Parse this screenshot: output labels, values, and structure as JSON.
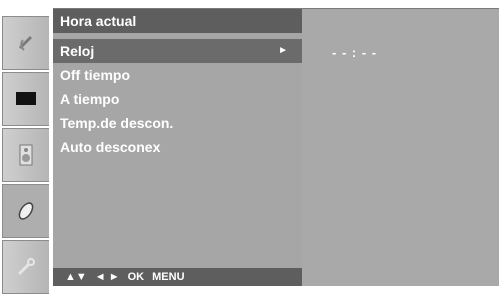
{
  "menu": {
    "title": "Hora actual",
    "items": [
      {
        "label": "Reloj",
        "selected": true,
        "has_submenu": true,
        "arrow": "►"
      },
      {
        "label": "Off tiempo",
        "selected": false
      },
      {
        "label": "A tiempo",
        "selected": false
      },
      {
        "label": "Temp.de descon.",
        "selected": false
      },
      {
        "label": "Auto desconex",
        "selected": false
      }
    ]
  },
  "value": {
    "clock": "- - : - -"
  },
  "footer": {
    "nav_updown": "▲▼",
    "nav_leftright": "◄ ►",
    "ok": "OK",
    "menu": "MENU"
  },
  "sidebar": {
    "tabs": [
      {
        "icon": "satellite-dish-icon",
        "active": false
      },
      {
        "icon": "screen-icon",
        "active": false
      },
      {
        "icon": "speaker-icon",
        "active": false
      },
      {
        "icon": "clock-icon",
        "active": true
      },
      {
        "icon": "settings-icon",
        "active": false
      }
    ]
  },
  "colors": {
    "title_bar": "#5e5e5e",
    "panel": "#a6a6a6",
    "selected_row": "#6b6b6b"
  }
}
